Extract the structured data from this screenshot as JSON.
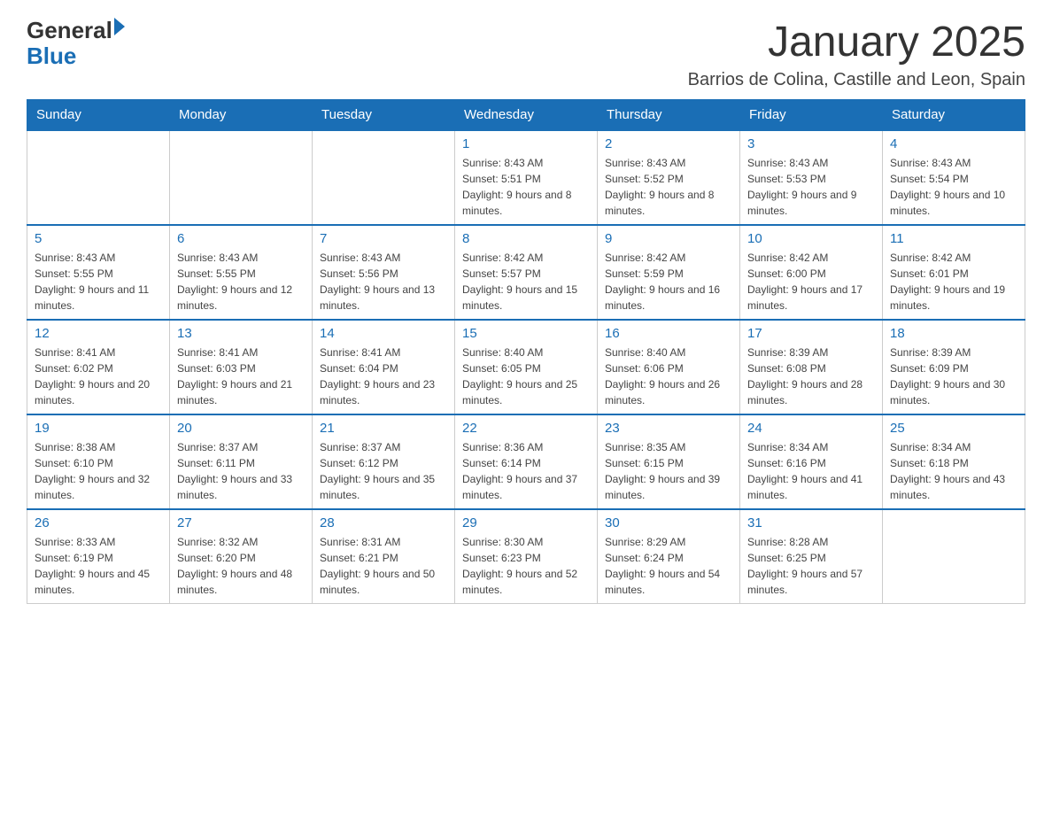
{
  "header": {
    "logo": {
      "text_general": "General",
      "text_blue": "Blue",
      "arrow": true
    },
    "title": "January 2025",
    "subtitle": "Barrios de Colina, Castille and Leon, Spain"
  },
  "calendar": {
    "days_of_week": [
      "Sunday",
      "Monday",
      "Tuesday",
      "Wednesday",
      "Thursday",
      "Friday",
      "Saturday"
    ],
    "weeks": [
      [
        null,
        null,
        null,
        {
          "day": "1",
          "sunrise": "Sunrise: 8:43 AM",
          "sunset": "Sunset: 5:51 PM",
          "daylight": "Daylight: 9 hours and 8 minutes."
        },
        {
          "day": "2",
          "sunrise": "Sunrise: 8:43 AM",
          "sunset": "Sunset: 5:52 PM",
          "daylight": "Daylight: 9 hours and 8 minutes."
        },
        {
          "day": "3",
          "sunrise": "Sunrise: 8:43 AM",
          "sunset": "Sunset: 5:53 PM",
          "daylight": "Daylight: 9 hours and 9 minutes."
        },
        {
          "day": "4",
          "sunrise": "Sunrise: 8:43 AM",
          "sunset": "Sunset: 5:54 PM",
          "daylight": "Daylight: 9 hours and 10 minutes."
        }
      ],
      [
        {
          "day": "5",
          "sunrise": "Sunrise: 8:43 AM",
          "sunset": "Sunset: 5:55 PM",
          "daylight": "Daylight: 9 hours and 11 minutes."
        },
        {
          "day": "6",
          "sunrise": "Sunrise: 8:43 AM",
          "sunset": "Sunset: 5:55 PM",
          "daylight": "Daylight: 9 hours and 12 minutes."
        },
        {
          "day": "7",
          "sunrise": "Sunrise: 8:43 AM",
          "sunset": "Sunset: 5:56 PM",
          "daylight": "Daylight: 9 hours and 13 minutes."
        },
        {
          "day": "8",
          "sunrise": "Sunrise: 8:42 AM",
          "sunset": "Sunset: 5:57 PM",
          "daylight": "Daylight: 9 hours and 15 minutes."
        },
        {
          "day": "9",
          "sunrise": "Sunrise: 8:42 AM",
          "sunset": "Sunset: 5:59 PM",
          "daylight": "Daylight: 9 hours and 16 minutes."
        },
        {
          "day": "10",
          "sunrise": "Sunrise: 8:42 AM",
          "sunset": "Sunset: 6:00 PM",
          "daylight": "Daylight: 9 hours and 17 minutes."
        },
        {
          "day": "11",
          "sunrise": "Sunrise: 8:42 AM",
          "sunset": "Sunset: 6:01 PM",
          "daylight": "Daylight: 9 hours and 19 minutes."
        }
      ],
      [
        {
          "day": "12",
          "sunrise": "Sunrise: 8:41 AM",
          "sunset": "Sunset: 6:02 PM",
          "daylight": "Daylight: 9 hours and 20 minutes."
        },
        {
          "day": "13",
          "sunrise": "Sunrise: 8:41 AM",
          "sunset": "Sunset: 6:03 PM",
          "daylight": "Daylight: 9 hours and 21 minutes."
        },
        {
          "day": "14",
          "sunrise": "Sunrise: 8:41 AM",
          "sunset": "Sunset: 6:04 PM",
          "daylight": "Daylight: 9 hours and 23 minutes."
        },
        {
          "day": "15",
          "sunrise": "Sunrise: 8:40 AM",
          "sunset": "Sunset: 6:05 PM",
          "daylight": "Daylight: 9 hours and 25 minutes."
        },
        {
          "day": "16",
          "sunrise": "Sunrise: 8:40 AM",
          "sunset": "Sunset: 6:06 PM",
          "daylight": "Daylight: 9 hours and 26 minutes."
        },
        {
          "day": "17",
          "sunrise": "Sunrise: 8:39 AM",
          "sunset": "Sunset: 6:08 PM",
          "daylight": "Daylight: 9 hours and 28 minutes."
        },
        {
          "day": "18",
          "sunrise": "Sunrise: 8:39 AM",
          "sunset": "Sunset: 6:09 PM",
          "daylight": "Daylight: 9 hours and 30 minutes."
        }
      ],
      [
        {
          "day": "19",
          "sunrise": "Sunrise: 8:38 AM",
          "sunset": "Sunset: 6:10 PM",
          "daylight": "Daylight: 9 hours and 32 minutes."
        },
        {
          "day": "20",
          "sunrise": "Sunrise: 8:37 AM",
          "sunset": "Sunset: 6:11 PM",
          "daylight": "Daylight: 9 hours and 33 minutes."
        },
        {
          "day": "21",
          "sunrise": "Sunrise: 8:37 AM",
          "sunset": "Sunset: 6:12 PM",
          "daylight": "Daylight: 9 hours and 35 minutes."
        },
        {
          "day": "22",
          "sunrise": "Sunrise: 8:36 AM",
          "sunset": "Sunset: 6:14 PM",
          "daylight": "Daylight: 9 hours and 37 minutes."
        },
        {
          "day": "23",
          "sunrise": "Sunrise: 8:35 AM",
          "sunset": "Sunset: 6:15 PM",
          "daylight": "Daylight: 9 hours and 39 minutes."
        },
        {
          "day": "24",
          "sunrise": "Sunrise: 8:34 AM",
          "sunset": "Sunset: 6:16 PM",
          "daylight": "Daylight: 9 hours and 41 minutes."
        },
        {
          "day": "25",
          "sunrise": "Sunrise: 8:34 AM",
          "sunset": "Sunset: 6:18 PM",
          "daylight": "Daylight: 9 hours and 43 minutes."
        }
      ],
      [
        {
          "day": "26",
          "sunrise": "Sunrise: 8:33 AM",
          "sunset": "Sunset: 6:19 PM",
          "daylight": "Daylight: 9 hours and 45 minutes."
        },
        {
          "day": "27",
          "sunrise": "Sunrise: 8:32 AM",
          "sunset": "Sunset: 6:20 PM",
          "daylight": "Daylight: 9 hours and 48 minutes."
        },
        {
          "day": "28",
          "sunrise": "Sunrise: 8:31 AM",
          "sunset": "Sunset: 6:21 PM",
          "daylight": "Daylight: 9 hours and 50 minutes."
        },
        {
          "day": "29",
          "sunrise": "Sunrise: 8:30 AM",
          "sunset": "Sunset: 6:23 PM",
          "daylight": "Daylight: 9 hours and 52 minutes."
        },
        {
          "day": "30",
          "sunrise": "Sunrise: 8:29 AM",
          "sunset": "Sunset: 6:24 PM",
          "daylight": "Daylight: 9 hours and 54 minutes."
        },
        {
          "day": "31",
          "sunrise": "Sunrise: 8:28 AM",
          "sunset": "Sunset: 6:25 PM",
          "daylight": "Daylight: 9 hours and 57 minutes."
        },
        null
      ]
    ]
  }
}
